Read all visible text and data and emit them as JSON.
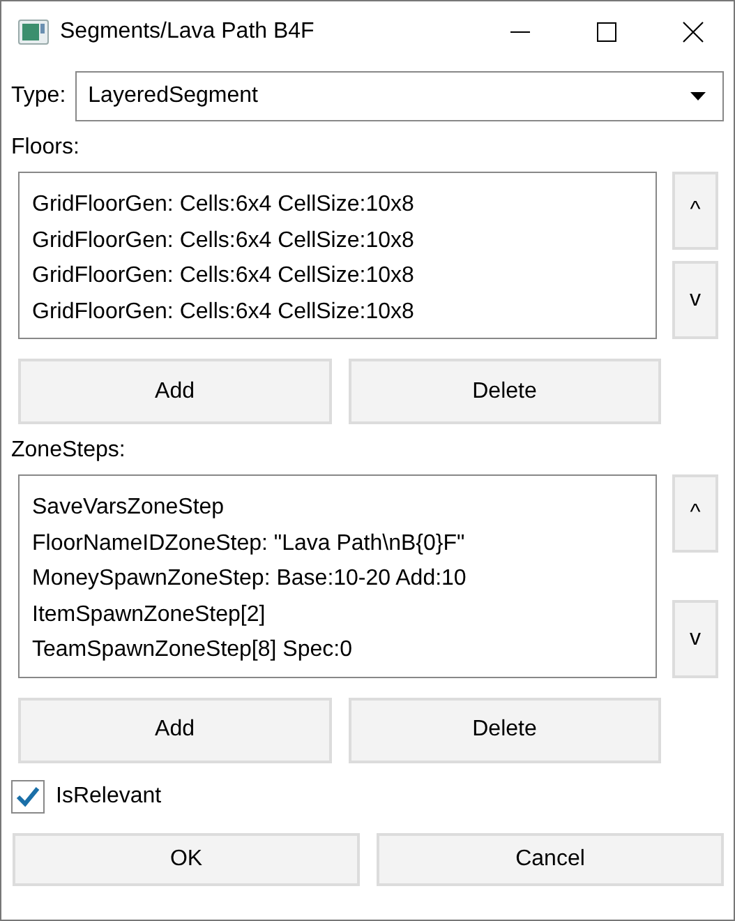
{
  "window": {
    "title": "Segments/Lava Path B4F"
  },
  "type_field": {
    "label": "Type:",
    "value": "LayeredSegment"
  },
  "sections": [
    {
      "label": "Floors:",
      "items": [
        "GridFloorGen: Cells:6x4 CellSize:10x8",
        "GridFloorGen: Cells:6x4 CellSize:10x8",
        "GridFloorGen: Cells:6x4 CellSize:10x8",
        "GridFloorGen: Cells:6x4 CellSize:10x8"
      ],
      "up_button": "^",
      "down_button": "v",
      "add_button": "Add",
      "delete_button": "Delete"
    },
    {
      "label": "ZoneSteps:",
      "items": [
        "SaveVarsZoneStep",
        "FloorNameIDZoneStep: \"Lava Path\\nB{0}F\"",
        "MoneySpawnZoneStep: Base:10-20 Add:10",
        "ItemSpawnZoneStep[2]",
        "TeamSpawnZoneStep[8] Spec:0"
      ],
      "up_button": "^",
      "down_button": "v",
      "add_button": "Add",
      "delete_button": "Delete"
    }
  ],
  "is_relevant": {
    "label": "IsRelevant",
    "checked": true
  },
  "buttons": [
    "OK",
    "Cancel"
  ]
}
